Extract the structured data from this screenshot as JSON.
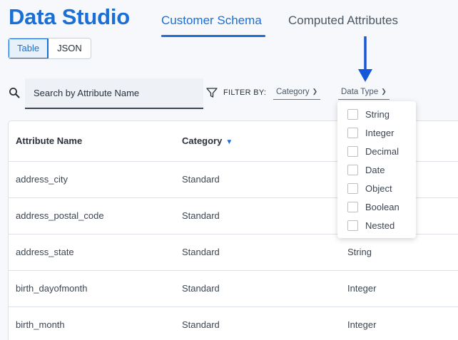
{
  "header": {
    "app_title": "Data Studio",
    "tabs": [
      {
        "label": "Customer Schema",
        "active": true
      },
      {
        "label": "Computed Attributes",
        "active": false
      }
    ]
  },
  "view_toggle": {
    "options": [
      "Table",
      "JSON"
    ],
    "selected": "Table"
  },
  "search": {
    "placeholder": "Search by Attribute Name",
    "value": ""
  },
  "filters": {
    "label": "FILTER BY:",
    "category": "Category",
    "data_type": "Data Type"
  },
  "data_type_menu": {
    "options": [
      {
        "label": "String",
        "checked": false
      },
      {
        "label": "Integer",
        "checked": false
      },
      {
        "label": "Decimal",
        "checked": false
      },
      {
        "label": "Date",
        "checked": false
      },
      {
        "label": "Object",
        "checked": false
      },
      {
        "label": "Boolean",
        "checked": false
      },
      {
        "label": "Nested",
        "checked": false
      }
    ]
  },
  "table": {
    "columns": [
      "Attribute Name",
      "Category"
    ],
    "sort_indicator": "▼",
    "rows": [
      {
        "name": "address_city",
        "category": "Standard",
        "data_type": ""
      },
      {
        "name": "address_postal_code",
        "category": "Standard",
        "data_type": ""
      },
      {
        "name": "address_state",
        "category": "Standard",
        "data_type": "String"
      },
      {
        "name": "birth_dayofmonth",
        "category": "Standard",
        "data_type": "Integer"
      },
      {
        "name": "birth_month",
        "category": "Standard",
        "data_type": "Integer"
      }
    ]
  },
  "colors": {
    "accent": "#1a6fd6",
    "background": "#f6f8fb",
    "text": "#28313b"
  },
  "icons": {
    "search": "search-icon",
    "filter": "filter-icon",
    "chevron": "chevron-down-icon",
    "arrow": "arrow-down-icon"
  }
}
